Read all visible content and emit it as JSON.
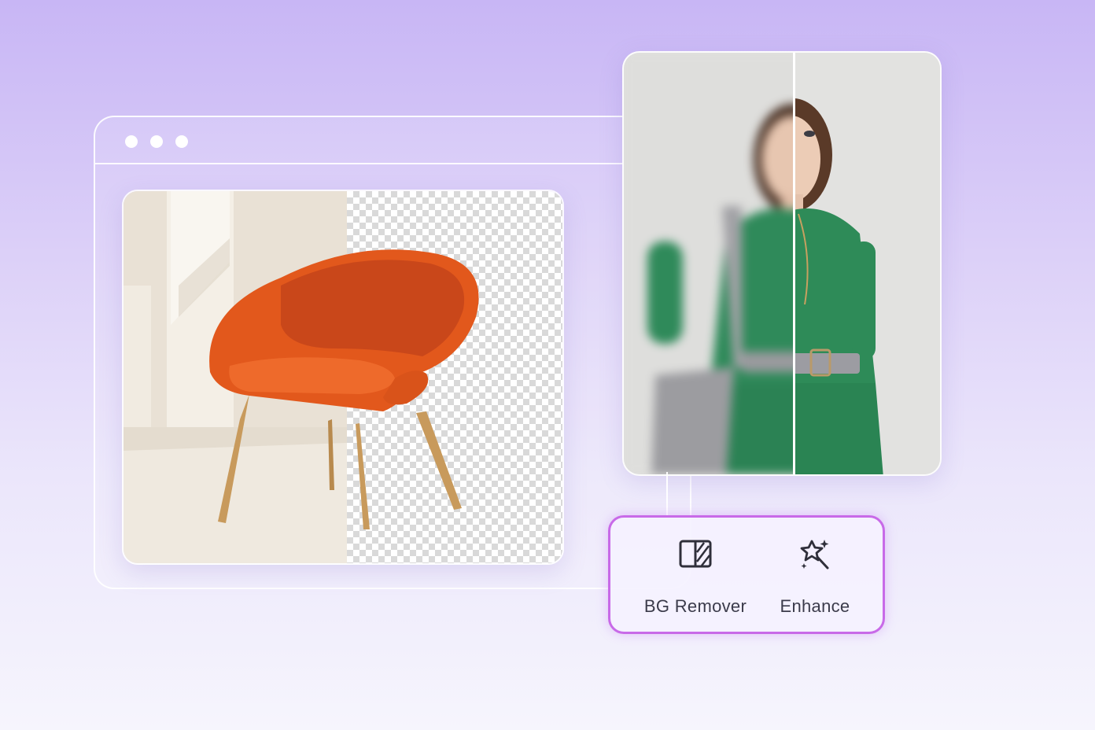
{
  "browser": {
    "window_dots": [
      "dot",
      "dot",
      "dot"
    ]
  },
  "chair_preview": {
    "left_state": "original background",
    "right_state": "transparent background"
  },
  "model_preview": {
    "left_state": "blurred",
    "right_state": "enhanced"
  },
  "tools": [
    {
      "label": "BG Remover",
      "icon": "bg-remover-icon"
    },
    {
      "label": "Enhance",
      "icon": "enhance-sparkle-icon"
    }
  ],
  "colors": {
    "panel_border": "#c86ae8",
    "chair_orange": "#e2581c",
    "dress_green": "#2f8a5a",
    "background_top": "#c8b6f5",
    "background_bottom": "#f6f5fd"
  }
}
